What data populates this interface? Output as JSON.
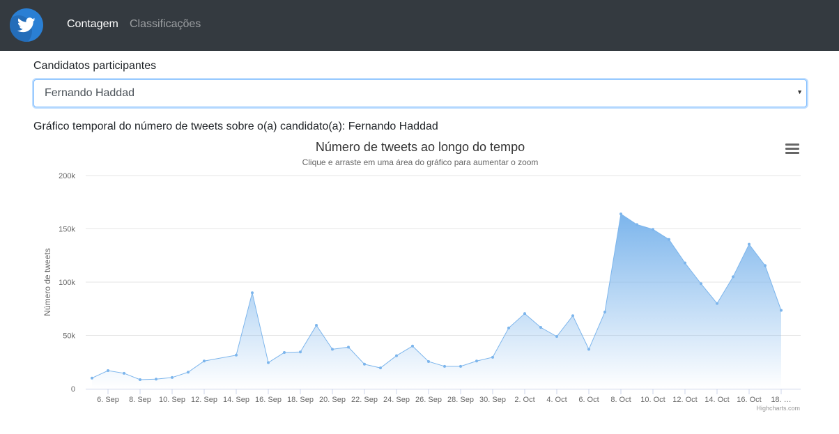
{
  "navbar": {
    "logo_icon": "twitter-bird-icon",
    "links": [
      {
        "label": "Contagem",
        "active": true
      },
      {
        "label": "Classificações",
        "active": false
      }
    ]
  },
  "form": {
    "label": "Candidatos participantes",
    "selected": "Fernando Haddad"
  },
  "caption": "Gráfico temporal do número de tweets sobre o(a) candidato(a): Fernando Haddad",
  "colors": {
    "navbar": "#343a40",
    "series_line": "#7cb5ec",
    "focus_border": "#80bdff"
  },
  "chart": {
    "menu_icon": "hamburger-menu-icon",
    "credits": "Highcharts.com"
  },
  "chart_data": {
    "type": "area",
    "title": "Número de tweets ao longo do tempo",
    "subtitle": "Clique e arraste em uma área do gráfico para aumentar o zoom",
    "ylabel": "Número de tweets",
    "xlabel": "",
    "ylim": [
      0,
      200000
    ],
    "yticks": [
      0,
      50000,
      100000,
      150000,
      200000
    ],
    "ytick_labels": [
      "0",
      "50k",
      "100k",
      "150k",
      "200k"
    ],
    "grid": true,
    "legend": "none",
    "x_tick_labels": [
      "6. Sep",
      "8. Sep",
      "10. Sep",
      "12. Sep",
      "14. Sep",
      "16. Sep",
      "18. Sep",
      "20. Sep",
      "22. Sep",
      "24. Sep",
      "26. Sep",
      "28. Sep",
      "30. Sep",
      "2. Oct",
      "4. Oct",
      "6. Oct",
      "8. Oct",
      "10. Oct",
      "12. Oct",
      "14. Oct",
      "16. Oct",
      "18. …"
    ],
    "x": [
      "5. Sep",
      "6. Sep",
      "7. Sep",
      "8. Sep",
      "9. Sep",
      "10. Sep",
      "11. Sep",
      "12. Sep",
      "14. Sep",
      "15. Sep",
      "16. Sep",
      "17. Sep",
      "18. Sep",
      "19. Sep",
      "20. Sep",
      "21. Sep",
      "22. Sep",
      "23. Sep",
      "24. Sep",
      "25. Sep",
      "26. Sep",
      "27. Sep",
      "28. Sep",
      "29. Sep",
      "30. Sep",
      "1. Oct",
      "2. Oct",
      "3. Oct",
      "4. Oct",
      "5. Oct",
      "6. Oct",
      "7. Oct",
      "8. Oct",
      "9. Oct",
      "10. Oct",
      "11. Oct",
      "12. Oct",
      "13. Oct",
      "14. Oct",
      "15. Oct",
      "16. Oct",
      "17. Oct",
      "18. Oct"
    ],
    "values": [
      10000,
      17000,
      14500,
      8500,
      9000,
      10500,
      15500,
      26000,
      31500,
      90000,
      24500,
      34000,
      34500,
      59500,
      37000,
      39000,
      23000,
      19500,
      31000,
      40000,
      25500,
      21000,
      21000,
      26000,
      29500,
      57000,
      70500,
      57500,
      49000,
      68500,
      37000,
      72000,
      164000,
      154000,
      149500,
      140000,
      118000,
      98500,
      80000,
      105000,
      135500,
      115500,
      73500
    ]
  }
}
